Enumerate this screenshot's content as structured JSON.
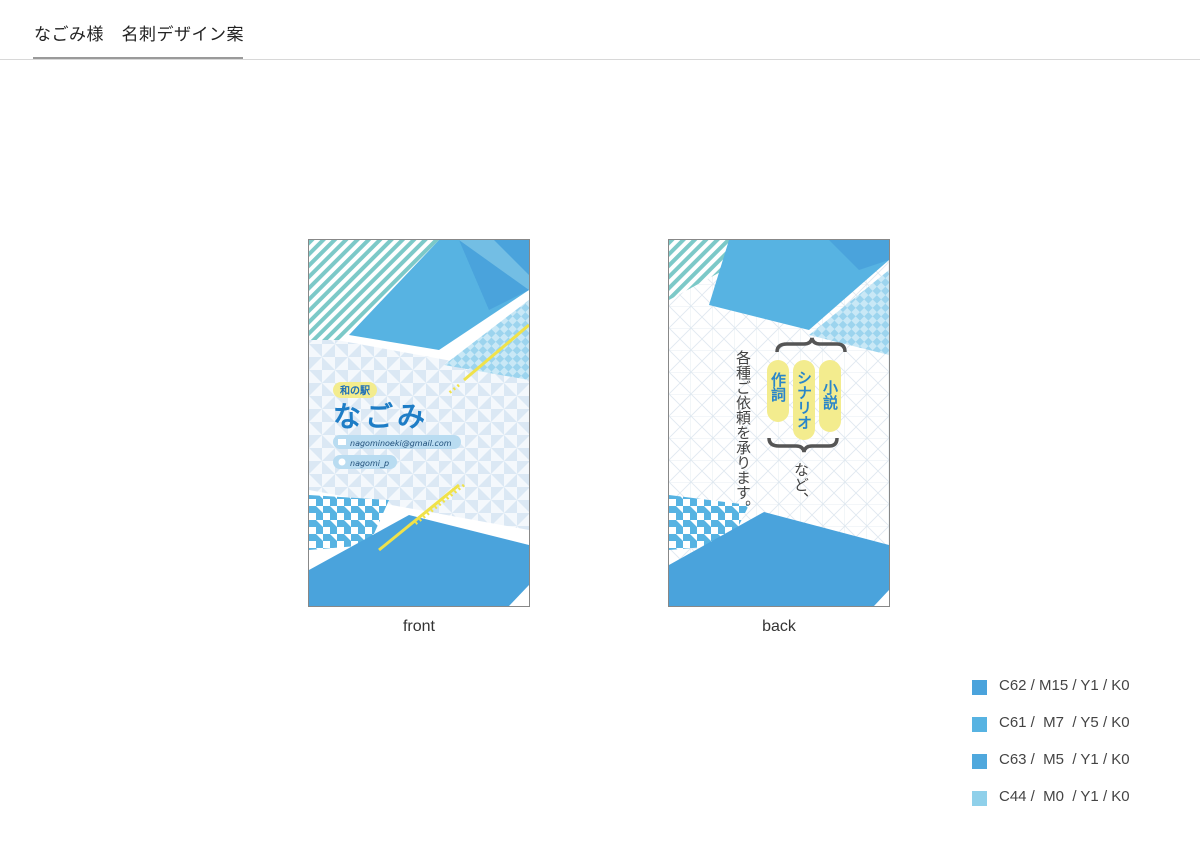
{
  "header": {
    "title": "なごみ様　名刺デザイン案"
  },
  "front": {
    "caption": "front",
    "badge": "和の駅",
    "name": "なごみ",
    "email": "nagominoeki@gmail.com",
    "twitter": "nagomi_p"
  },
  "back": {
    "caption": "back",
    "genres": [
      "小説",
      "シナリオ",
      "作詞"
    ],
    "suffix": "など、",
    "request_line": "各種ご依頼を承ります。"
  },
  "colors": {
    "primary": "#4aa3dc",
    "light": "#57b3e2",
    "medium": "#4fa8dd",
    "pale": "#8fd0ea",
    "teal": "#7cc9c8",
    "yellow": "#f3ec8e"
  },
  "legend": [
    {
      "label": "C62 / M15 / Y1 / K0",
      "color": "#4aa3dc"
    },
    {
      "label": "C61 /  M7  / Y5 / K0",
      "color": "#57b3e2"
    },
    {
      "label": "C63 /  M5  / Y1 / K0",
      "color": "#4fa8dd"
    },
    {
      "label": "C44 /  M0  / Y1 / K0",
      "color": "#8fd0ea"
    }
  ]
}
